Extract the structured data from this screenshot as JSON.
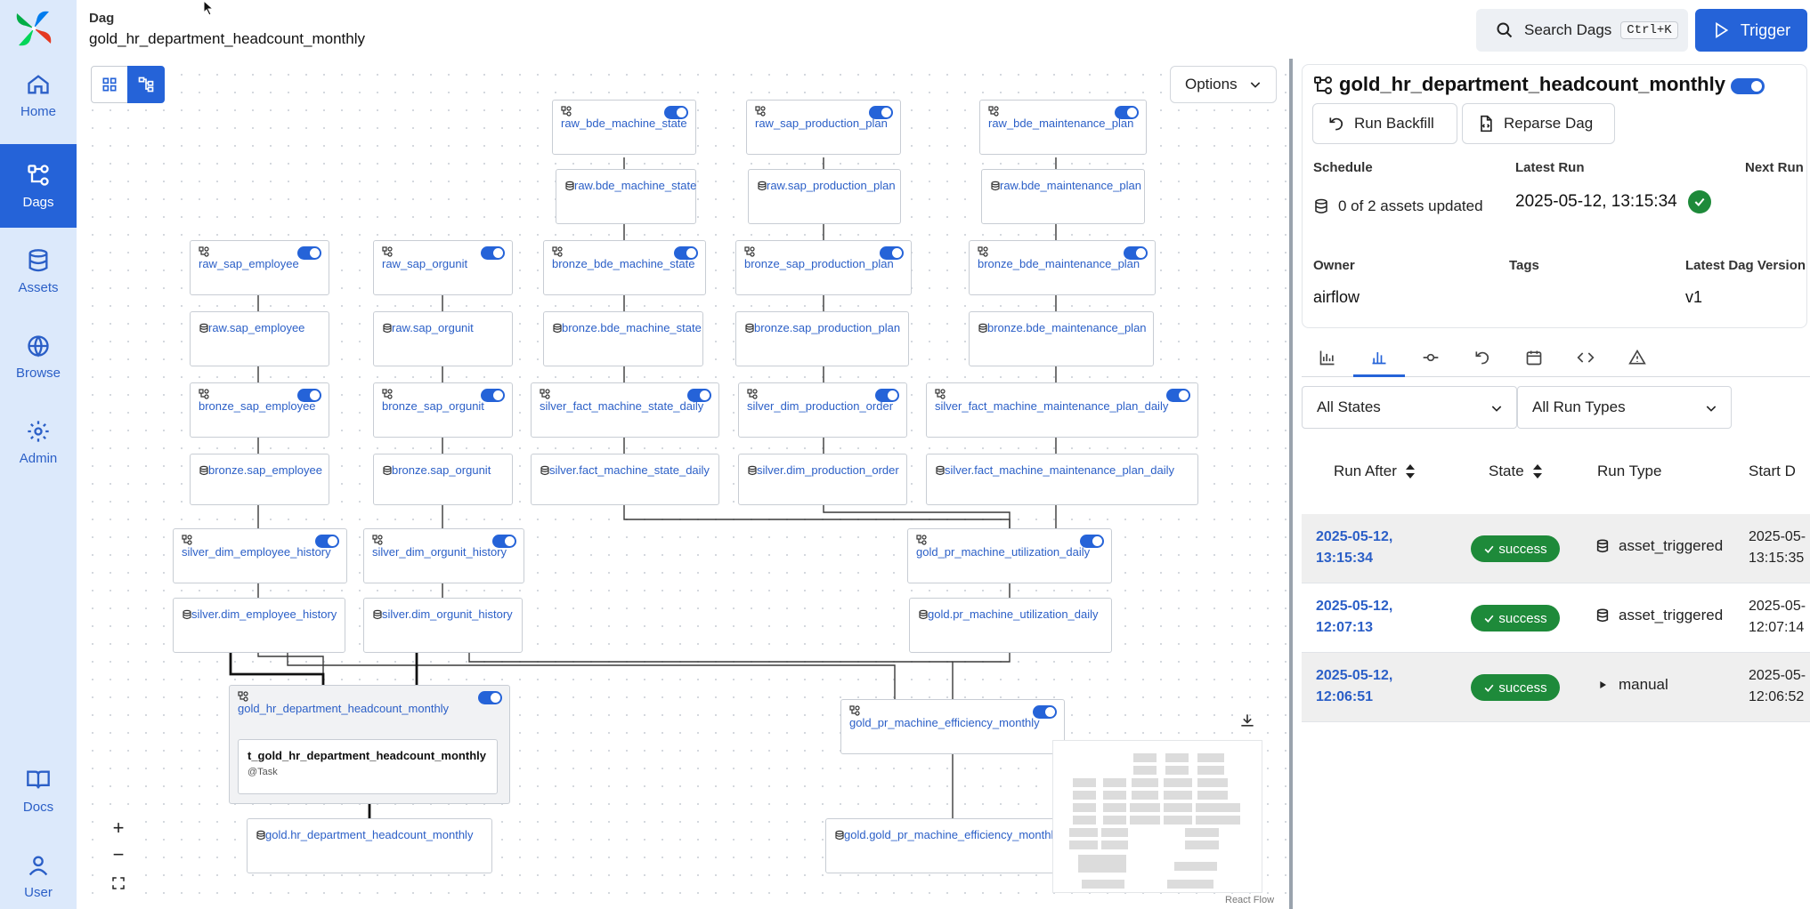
{
  "nav": {
    "items": [
      {
        "label": "Home",
        "icon": "home-icon"
      },
      {
        "label": "Dags",
        "icon": "dags-icon"
      },
      {
        "label": "Assets",
        "icon": "database-icon"
      },
      {
        "label": "Browse",
        "icon": "globe-icon"
      },
      {
        "label": "Admin",
        "icon": "gear-icon"
      },
      {
        "label": "Docs",
        "icon": "book-icon"
      },
      {
        "label": "User",
        "icon": "user-icon"
      }
    ],
    "active": "Dags"
  },
  "header": {
    "breadcrumb_label": "Dag",
    "dag_id": "gold_hr_department_headcount_monthly",
    "search_label": "Search Dags",
    "search_shortcut": "Ctrl+K",
    "trigger_label": "Trigger"
  },
  "graph": {
    "options_label": "Options",
    "react_flow_label": "React Flow",
    "nodes": {
      "raw_bde_machine_state": "raw_bde_machine_state",
      "raw_sap_production_plan": "raw_sap_production_plan",
      "raw_bde_maintenance_plan": "raw_bde_maintenance_plan",
      "asset_raw_bde_machine_state": "raw.bde_machine_state",
      "asset_raw_sap_production_plan": "raw.sap_production_plan",
      "asset_raw_bde_maintenance_plan": "raw.bde_maintenance_plan",
      "raw_sap_employee": "raw_sap_employee",
      "raw_sap_orgunit": "raw_sap_orgunit",
      "bronze_bde_machine_state": "bronze_bde_machine_state",
      "bronze_sap_production_plan": "bronze_sap_production_plan",
      "bronze_bde_maintenance_plan": "bronze_bde_maintenance_plan",
      "asset_raw_sap_employee": "raw.sap_employee",
      "asset_raw_sap_orgunit": "raw.sap_orgunit",
      "asset_bronze_bde_machine_state": "bronze.bde_machine_state",
      "asset_bronze_sap_production_plan": "bronze.sap_production_plan",
      "asset_bronze_bde_maintenance_plan": "bronze.bde_maintenance_plan",
      "bronze_sap_employee": "bronze_sap_employee",
      "bronze_sap_orgunit": "bronze_sap_orgunit",
      "silver_fact_machine_state_daily": "silver_fact_machine_state_daily",
      "silver_dim_production_order": "silver_dim_production_order",
      "silver_fact_machine_maintenance_plan_daily": "silver_fact_machine_maintenance_plan_daily",
      "asset_bronze_sap_employee": "bronze.sap_employee",
      "asset_bronze_sap_orgunit": "bronze.sap_orgunit",
      "asset_silver_fact_machine_state_daily": "silver.fact_machine_state_daily",
      "asset_silver_dim_production_order": "silver.dim_production_order",
      "asset_silver_fact_machine_maintenance_plan_daily": "silver.fact_machine_maintenance_plan_daily",
      "silver_dim_employee_history": "silver_dim_employee_history",
      "silver_dim_orgunit_history": "silver_dim_orgunit_history",
      "gold_pr_machine_utilization_daily": "gold_pr_machine_utilization_daily",
      "asset_silver_dim_employee_history": "silver.dim_employee_history",
      "asset_silver_dim_orgunit_history": "silver.dim_orgunit_history",
      "asset_gold_pr_machine_utilization_daily": "gold.pr_machine_utilization_daily",
      "gold_hr_department_headcount_monthly": "gold_hr_department_headcount_monthly",
      "gold_pr_machine_efficiency_monthly": "gold_pr_machine_efficiency_monthly",
      "asset_gold_hr_department_headcount_monthly": "gold.hr_department_headcount_monthly",
      "asset_gold_gold_pr_machine_efficiency_monthly": "gold.gold_pr_machine_efficiency_monthly"
    },
    "task": {
      "name": "t_gold_hr_department_headcount_monthly",
      "type": "@Task"
    }
  },
  "details": {
    "title": "gold_hr_department_headcount_monthly",
    "run_backfill_label": "Run Backfill",
    "reparse_label": "Reparse Dag",
    "schedule_label": "Schedule",
    "schedule_value": "0 of 2 assets updated",
    "latest_run_label": "Latest Run",
    "latest_run_value": "2025-05-12, 13:15:34",
    "next_run_label": "Next Run",
    "owner_label": "Owner",
    "owner_value": "airflow",
    "tags_label": "Tags",
    "version_label": "Latest Dag Version",
    "version_value": "v1"
  },
  "filters": {
    "state": "All States",
    "run_type": "All Run Types"
  },
  "runs_table": {
    "columns": [
      "Run After",
      "State",
      "Run Type",
      "Start D"
    ],
    "rows": [
      {
        "run_after_date": "2025-05-12,",
        "run_after_time": "13:15:34",
        "state": "success",
        "run_type": "asset_triggered",
        "start_date": "2025-05-",
        "start_time": "13:15:35"
      },
      {
        "run_after_date": "2025-05-12,",
        "run_after_time": "12:07:13",
        "state": "success",
        "run_type": "asset_triggered",
        "start_date": "2025-05-",
        "start_time": "12:07:14"
      },
      {
        "run_after_date": "2025-05-12,",
        "run_after_time": "12:06:51",
        "state": "success",
        "run_type": "manual",
        "start_date": "2025-05-",
        "start_time": "12:06:52"
      }
    ]
  },
  "colors": {
    "accent": "#2563d8",
    "success": "#1e8a3a",
    "sidebar_bg": "#dce9fb",
    "link": "#2b5fc7"
  }
}
